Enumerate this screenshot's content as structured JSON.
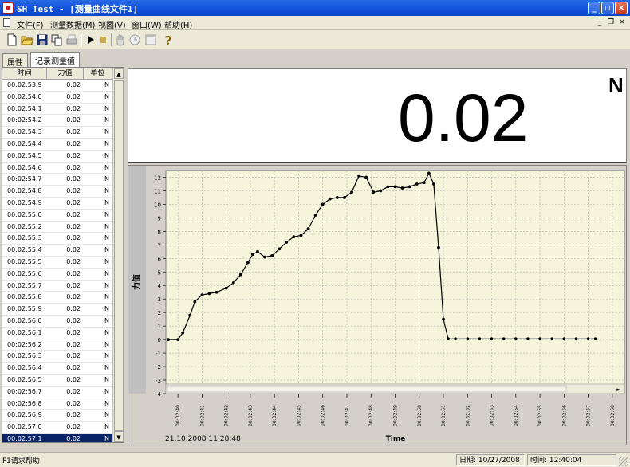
{
  "window": {
    "title": "SH Test - [测量曲线文件1]"
  },
  "menu": [
    "文件(F)",
    "测量数据(M)",
    "视图(V)",
    "窗口(W)",
    "帮助(H)"
  ],
  "tabs": [
    "属性",
    "记录测量值"
  ],
  "table": {
    "headers": [
      "时间",
      "力值",
      "单位"
    ],
    "rows": [
      {
        "time": "00:02:53.9",
        "value": "0.02",
        "unit": "N"
      },
      {
        "time": "00:02:54.0",
        "value": "0.02",
        "unit": "N"
      },
      {
        "time": "00:02:54.1",
        "value": "0.02",
        "unit": "N"
      },
      {
        "time": "00:02:54.2",
        "value": "0.02",
        "unit": "N"
      },
      {
        "time": "00:02:54.3",
        "value": "0.02",
        "unit": "N"
      },
      {
        "time": "00:02:54.4",
        "value": "0.02",
        "unit": "N"
      },
      {
        "time": "00:02:54.5",
        "value": "0.02",
        "unit": "N"
      },
      {
        "time": "00:02:54.6",
        "value": "0.02",
        "unit": "N"
      },
      {
        "time": "00:02:54.7",
        "value": "0.02",
        "unit": "N"
      },
      {
        "time": "00:02:54.8",
        "value": "0.02",
        "unit": "N"
      },
      {
        "time": "00:02:54.9",
        "value": "0.02",
        "unit": "N"
      },
      {
        "time": "00:02:55.0",
        "value": "0.02",
        "unit": "N"
      },
      {
        "time": "00:02:55.2",
        "value": "0.02",
        "unit": "N"
      },
      {
        "time": "00:02:55.3",
        "value": "0.02",
        "unit": "N"
      },
      {
        "time": "00:02:55.4",
        "value": "0.02",
        "unit": "N"
      },
      {
        "time": "00:02:55.5",
        "value": "0.02",
        "unit": "N"
      },
      {
        "time": "00:02:55.6",
        "value": "0.02",
        "unit": "N"
      },
      {
        "time": "00:02:55.7",
        "value": "0.02",
        "unit": "N"
      },
      {
        "time": "00:02:55.8",
        "value": "0.02",
        "unit": "N"
      },
      {
        "time": "00:02:55.9",
        "value": "0.02",
        "unit": "N"
      },
      {
        "time": "00:02:56.0",
        "value": "0.02",
        "unit": "N"
      },
      {
        "time": "00:02:56.1",
        "value": "0.02",
        "unit": "N"
      },
      {
        "time": "00:02:56.2",
        "value": "0.02",
        "unit": "N"
      },
      {
        "time": "00:02:56.3",
        "value": "0.02",
        "unit": "N"
      },
      {
        "time": "00:02:56.4",
        "value": "0.02",
        "unit": "N"
      },
      {
        "time": "00:02:56.5",
        "value": "0.02",
        "unit": "N"
      },
      {
        "time": "00:02:56.7",
        "value": "0.02",
        "unit": "N"
      },
      {
        "time": "00:02:56.8",
        "value": "0.02",
        "unit": "N"
      },
      {
        "time": "00:02:56.9",
        "value": "0.02",
        "unit": "N"
      },
      {
        "time": "00:02:57.0",
        "value": "0.02",
        "unit": "N"
      },
      {
        "time": "00:02:57.1",
        "value": "0.02",
        "unit": "N",
        "selected": true
      }
    ]
  },
  "display": {
    "value": "0.02",
    "unit": "N"
  },
  "chart_data": {
    "type": "line",
    "ylabel": "力值",
    "xlabel": "Time",
    "date_label": "21.10.2008  11:28:48",
    "ylim": [
      -4,
      12.5
    ],
    "yticks": [
      -4,
      -3,
      -2,
      -1,
      0,
      1,
      2,
      3,
      4,
      5,
      6,
      7,
      8,
      9,
      10,
      11,
      12
    ],
    "xlim": [
      39.5,
      58.5
    ],
    "xtick_seconds": [
      40,
      41,
      42,
      43,
      44,
      45,
      46,
      47,
      48,
      49,
      50,
      51,
      52,
      53,
      54,
      55,
      56,
      57,
      58
    ],
    "xtick_labels": [
      "00:02:40",
      "00:02:41",
      "00:02:42",
      "00:02:43",
      "00:02:44",
      "00:02:45",
      "00:02:46",
      "00:02:47",
      "00:02:48",
      "00:02:49",
      "00:02:50",
      "00:02:51",
      "00:02:52",
      "00:02:53",
      "00:02:54",
      "00:02:55",
      "00:02:56",
      "00:02:57",
      "00:02:58"
    ],
    "grid": true,
    "series": [
      {
        "color": "#000000",
        "x": [
          39.6,
          40.0,
          40.2,
          40.5,
          40.7,
          41.0,
          41.3,
          41.6,
          42.0,
          42.3,
          42.6,
          42.9,
          43.1,
          43.3,
          43.6,
          43.9,
          44.2,
          44.5,
          44.8,
          45.1,
          45.4,
          45.7,
          46.0,
          46.3,
          46.6,
          46.9,
          47.2,
          47.5,
          47.8,
          48.1,
          48.4,
          48.7,
          49.0,
          49.3,
          49.6,
          49.9,
          50.2,
          50.4,
          50.6,
          50.8,
          51.0,
          51.2,
          51.5,
          52.0,
          52.5,
          53.0,
          53.5,
          54.0,
          54.5,
          55.0,
          55.5,
          56.0,
          56.5,
          57.0,
          57.3
        ],
        "y": [
          0.0,
          0.0,
          0.5,
          1.8,
          2.8,
          3.3,
          3.4,
          3.5,
          3.8,
          4.2,
          4.8,
          5.7,
          6.3,
          6.5,
          6.1,
          6.2,
          6.7,
          7.2,
          7.6,
          7.7,
          8.2,
          9.2,
          10.0,
          10.4,
          10.5,
          10.5,
          10.9,
          12.1,
          12.0,
          10.9,
          11.0,
          11.3,
          11.3,
          11.2,
          11.3,
          11.5,
          11.6,
          12.3,
          11.5,
          6.8,
          1.5,
          0.05,
          0.05,
          0.05,
          0.05,
          0.05,
          0.05,
          0.05,
          0.05,
          0.05,
          0.05,
          0.05,
          0.05,
          0.05,
          0.05
        ]
      }
    ]
  },
  "status": {
    "help": "F1请求帮助",
    "date_label": "日期:",
    "date": "10/27/2008",
    "time_label": "时间:",
    "time": "12:40:04"
  },
  "colors": {
    "plot_background": "#f6f5dc",
    "selection": "#0a246a"
  }
}
